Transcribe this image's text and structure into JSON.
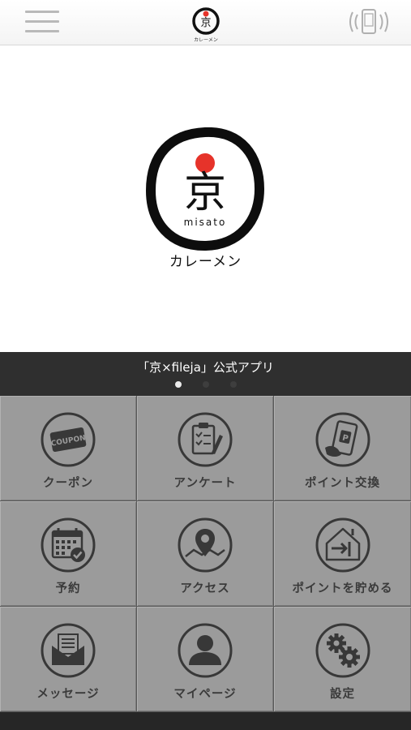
{
  "header": {
    "menu_icon": "hamburger-menu-icon",
    "logo_icon": "kyo-logo-icon",
    "logo_text": "カレーメン",
    "nfc_icon": "nfc-phone-icon"
  },
  "hero": {
    "logo_char": "京",
    "logo_sub": "misato",
    "subtitle": "カレーメン"
  },
  "banner": {
    "title": "「京×fileja」公式アプリ",
    "page_count": 3,
    "active_page": 1
  },
  "menu": [
    {
      "label": "クーポン",
      "icon": "coupon-icon"
    },
    {
      "label": "アンケート",
      "icon": "survey-clipboard-icon"
    },
    {
      "label": "ポイント交換",
      "icon": "point-exchange-phone-icon"
    },
    {
      "label": "予約",
      "icon": "calendar-check-icon"
    },
    {
      "label": "アクセス",
      "icon": "map-pin-icon"
    },
    {
      "label": "ポイントを貯める",
      "icon": "point-collect-house-icon"
    },
    {
      "label": "メッセージ",
      "icon": "message-envelope-icon"
    },
    {
      "label": "マイページ",
      "icon": "user-profile-icon"
    },
    {
      "label": "設定",
      "icon": "settings-gears-icon"
    }
  ],
  "colors": {
    "tile": "#9b9b9b",
    "banner": "#2f2f2f",
    "logo_red": "#e6332a",
    "label": "#3a3a3a"
  }
}
